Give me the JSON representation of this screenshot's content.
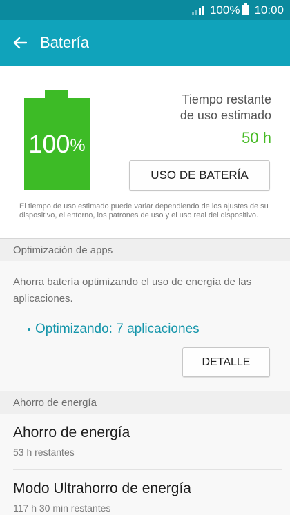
{
  "status_bar": {
    "battery_level": "100%",
    "time": "10:00"
  },
  "app_bar": {
    "title": "Batería"
  },
  "battery": {
    "percent_value": "100",
    "percent_unit": "%",
    "remaining_label_line1": "Tiempo restante",
    "remaining_label_line2": "de uso estimado",
    "remaining_value": "50 h",
    "usage_button_label": "USO DE BATERÍA",
    "disclaimer": "El tiempo de uso estimado puede variar dependiendo de los ajustes de su dispositivo, el entorno, los patrones de uso y el uso real del dispositivo.",
    "level_fraction": 1.0,
    "fill_color": "#3dbb26"
  },
  "app_optimization": {
    "header": "Optimización de apps",
    "description": "Ahorra batería optimizando el uso de energía de las aplicaciones.",
    "status": "Optimizando: 7 aplicaciones",
    "detail_button_label": "DETALLE"
  },
  "power_saving": {
    "header": "Ahorro de energía",
    "items": [
      {
        "title": "Ahorro de energía",
        "subtitle": "53 h restantes"
      },
      {
        "title": "Modo Ultrahorro de energía",
        "subtitle": "117 h 30 min restantes"
      }
    ]
  },
  "icons": {
    "back": "arrow-left-icon",
    "signal": "signal-icon",
    "battery": "battery-icon"
  },
  "colors": {
    "status_bar": "#0b8a9e",
    "app_bar": "#10a3bb",
    "accent_green": "#46ba24",
    "accent_teal": "#1696ab"
  }
}
